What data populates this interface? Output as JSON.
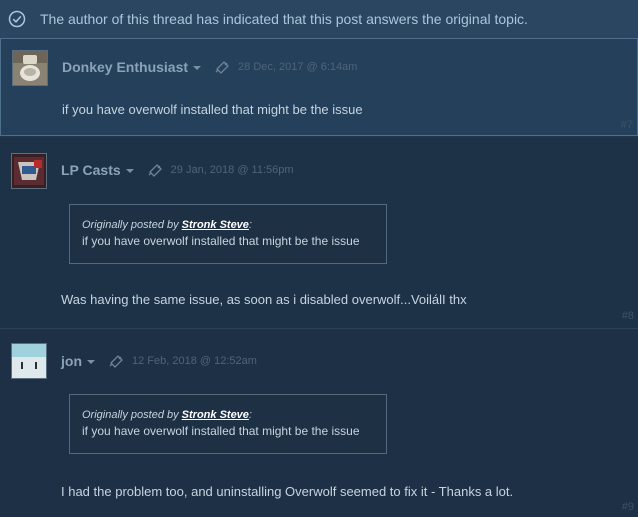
{
  "banner": {
    "text": "The author of this thread has indicated that this post answers the original topic.",
    "icon": "check-circle-icon"
  },
  "posts": [
    {
      "author": "Donkey Enthusiast",
      "timestamp": "28 Dec, 2017 @ 6:14am",
      "body": "if you have overwolf installed that might be the issue",
      "number": "#7",
      "avatar": "toilet-photo-avatar"
    },
    {
      "author": "LP Casts",
      "timestamp": "29 Jan, 2018 @ 11:56pm",
      "quote": {
        "prefix": "Originally posted by",
        "name": "Stronk Steve",
        "suffix": ":",
        "text": "if you have overwolf installed that might be the issue"
      },
      "body": "Was having the same issue, as soon as i disabled overwolf...VoilálI thx",
      "number": "#8",
      "avatar": "logo-avatar"
    },
    {
      "author": "jon",
      "timestamp": "12 Feb, 2018 @ 12:52am",
      "quote": {
        "prefix": "Originally posted by",
        "name": "Stronk Steve",
        "suffix": ":",
        "text": "if you have overwolf installed that might be the issue"
      },
      "body": "I had the problem too, and uninstalling Overwolf seemed to fix it - Thanks a lot.",
      "number": "#9",
      "avatar": "cartoon-face-avatar"
    }
  ],
  "colors": {
    "background": "#1f2f42",
    "banner": "#2a4661",
    "author": "#8ba3b8",
    "timestamp": "#4f6478"
  }
}
